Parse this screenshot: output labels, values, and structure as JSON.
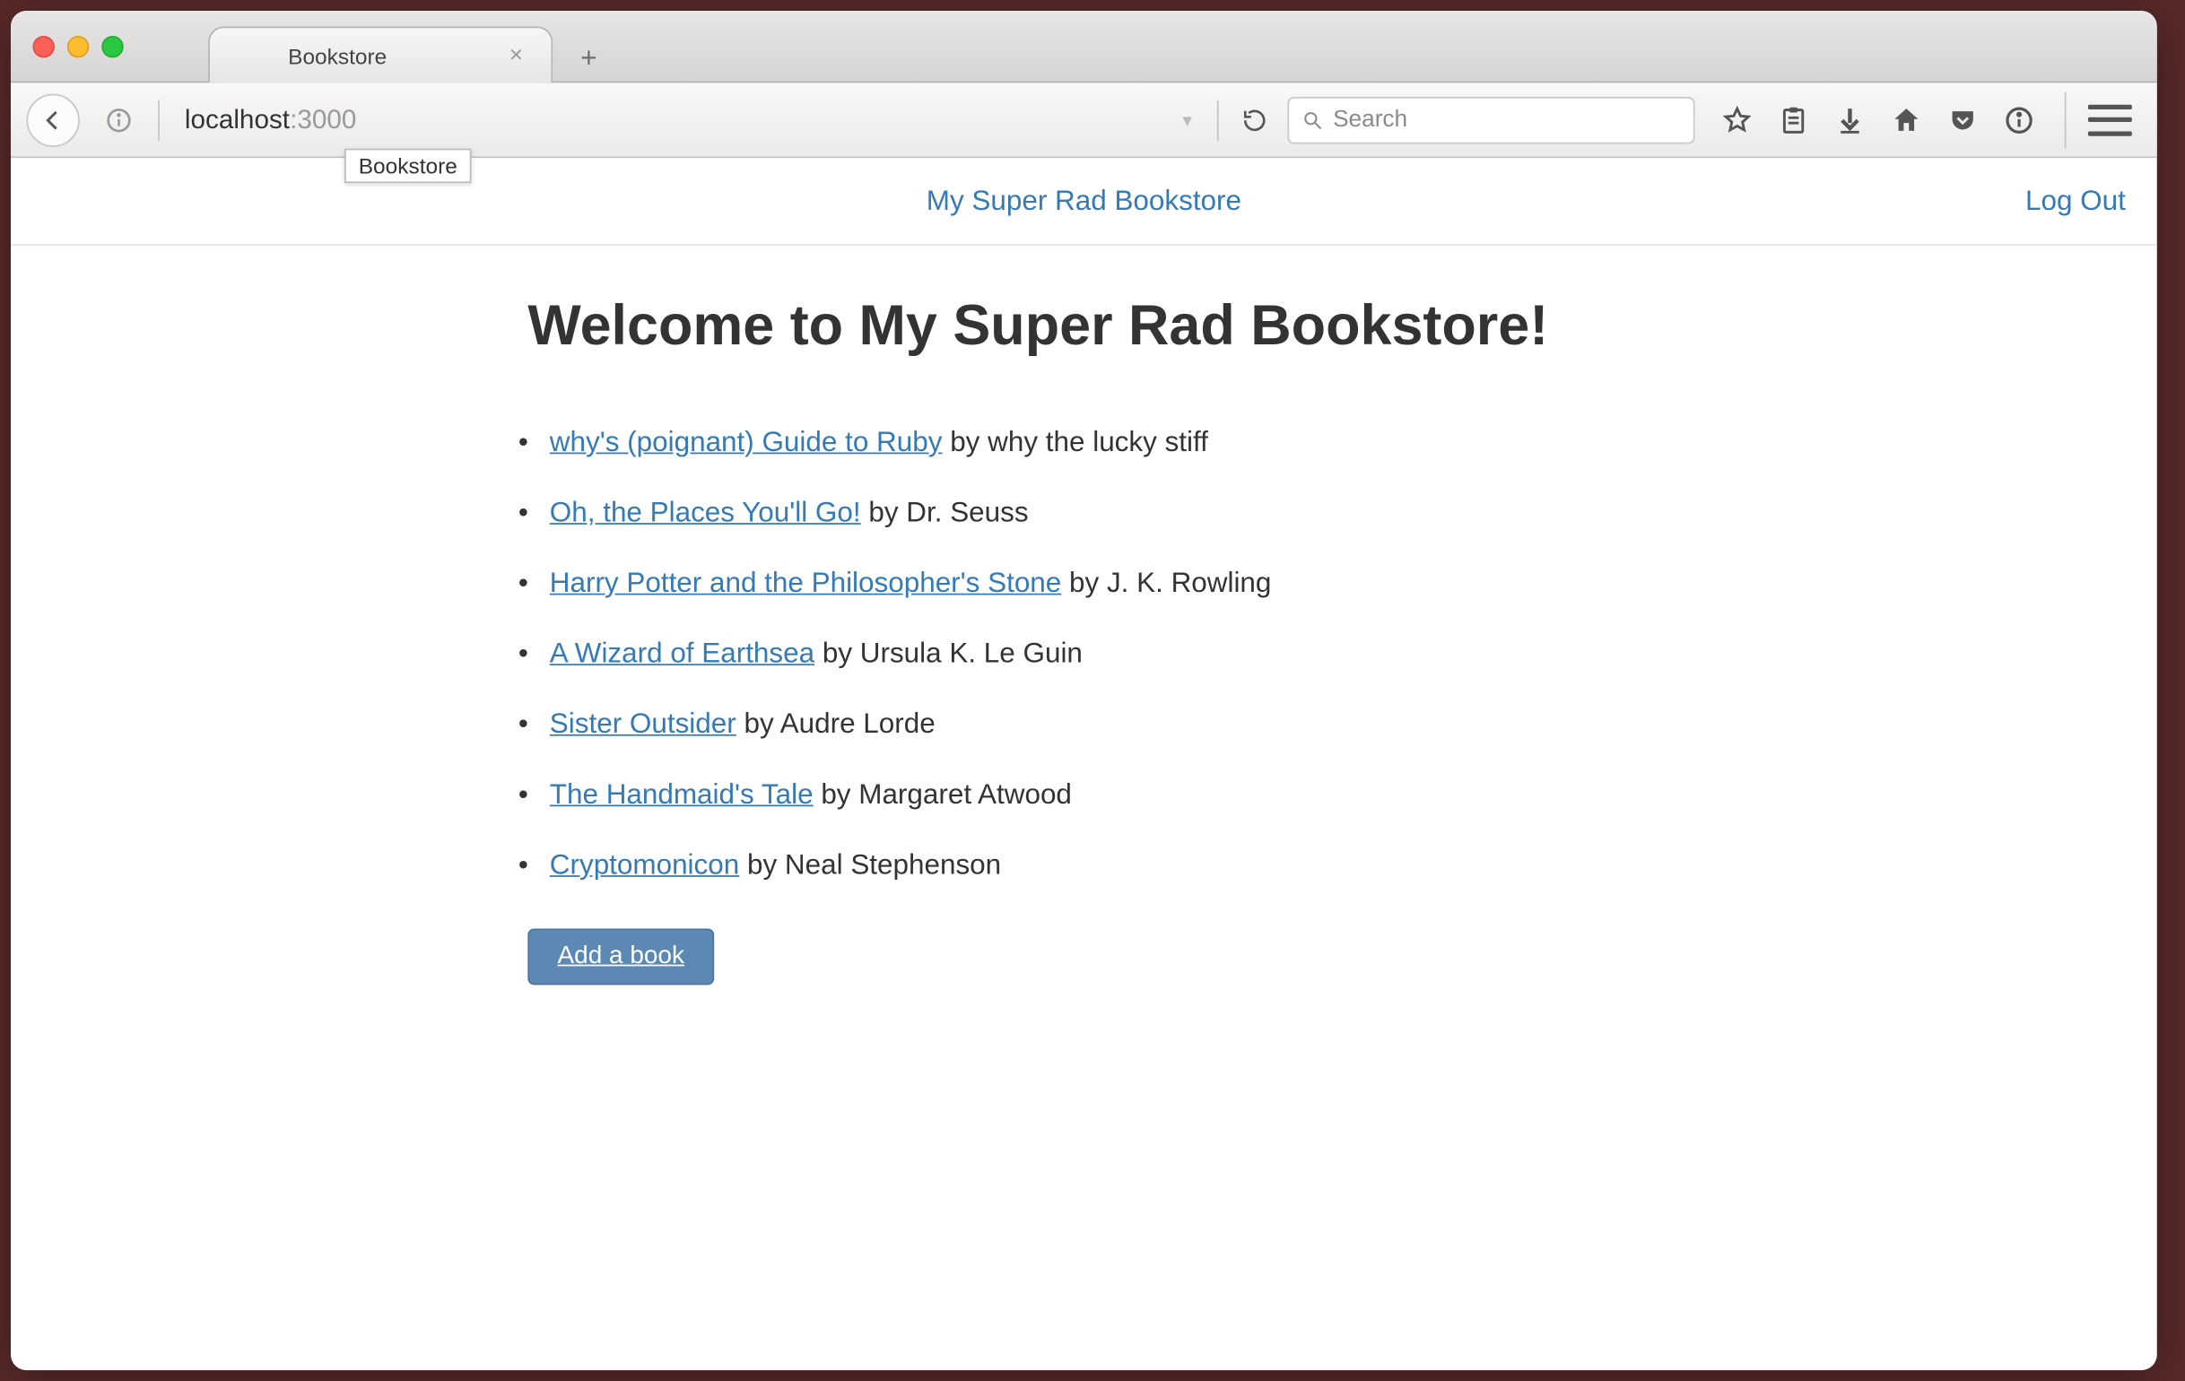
{
  "browser": {
    "tab_title": "Bookstore",
    "tooltip": "Bookstore",
    "address_host": "localhost",
    "address_port": ":3000",
    "search_placeholder": "Search"
  },
  "nav": {
    "brand": "My Super Rad Bookstore",
    "logout": "Log Out"
  },
  "page": {
    "heading": "Welcome to My Super Rad Bookstore!",
    "add_button": "Add a book",
    "by_word": " by "
  },
  "books": [
    {
      "title": "why's (poignant) Guide to Ruby",
      "author": "why the lucky stiff"
    },
    {
      "title": "Oh, the Places You'll Go!",
      "author": "Dr. Seuss"
    },
    {
      "title": "Harry Potter and the Philosopher's Stone",
      "author": "J. K. Rowling"
    },
    {
      "title": "A Wizard of Earthsea",
      "author": "Ursula K. Le Guin"
    },
    {
      "title": "Sister Outsider",
      "author": "Audre Lorde"
    },
    {
      "title": "The Handmaid's Tale",
      "author": "Margaret Atwood"
    },
    {
      "title": "Cryptomonicon",
      "author": "Neal Stephenson"
    }
  ]
}
